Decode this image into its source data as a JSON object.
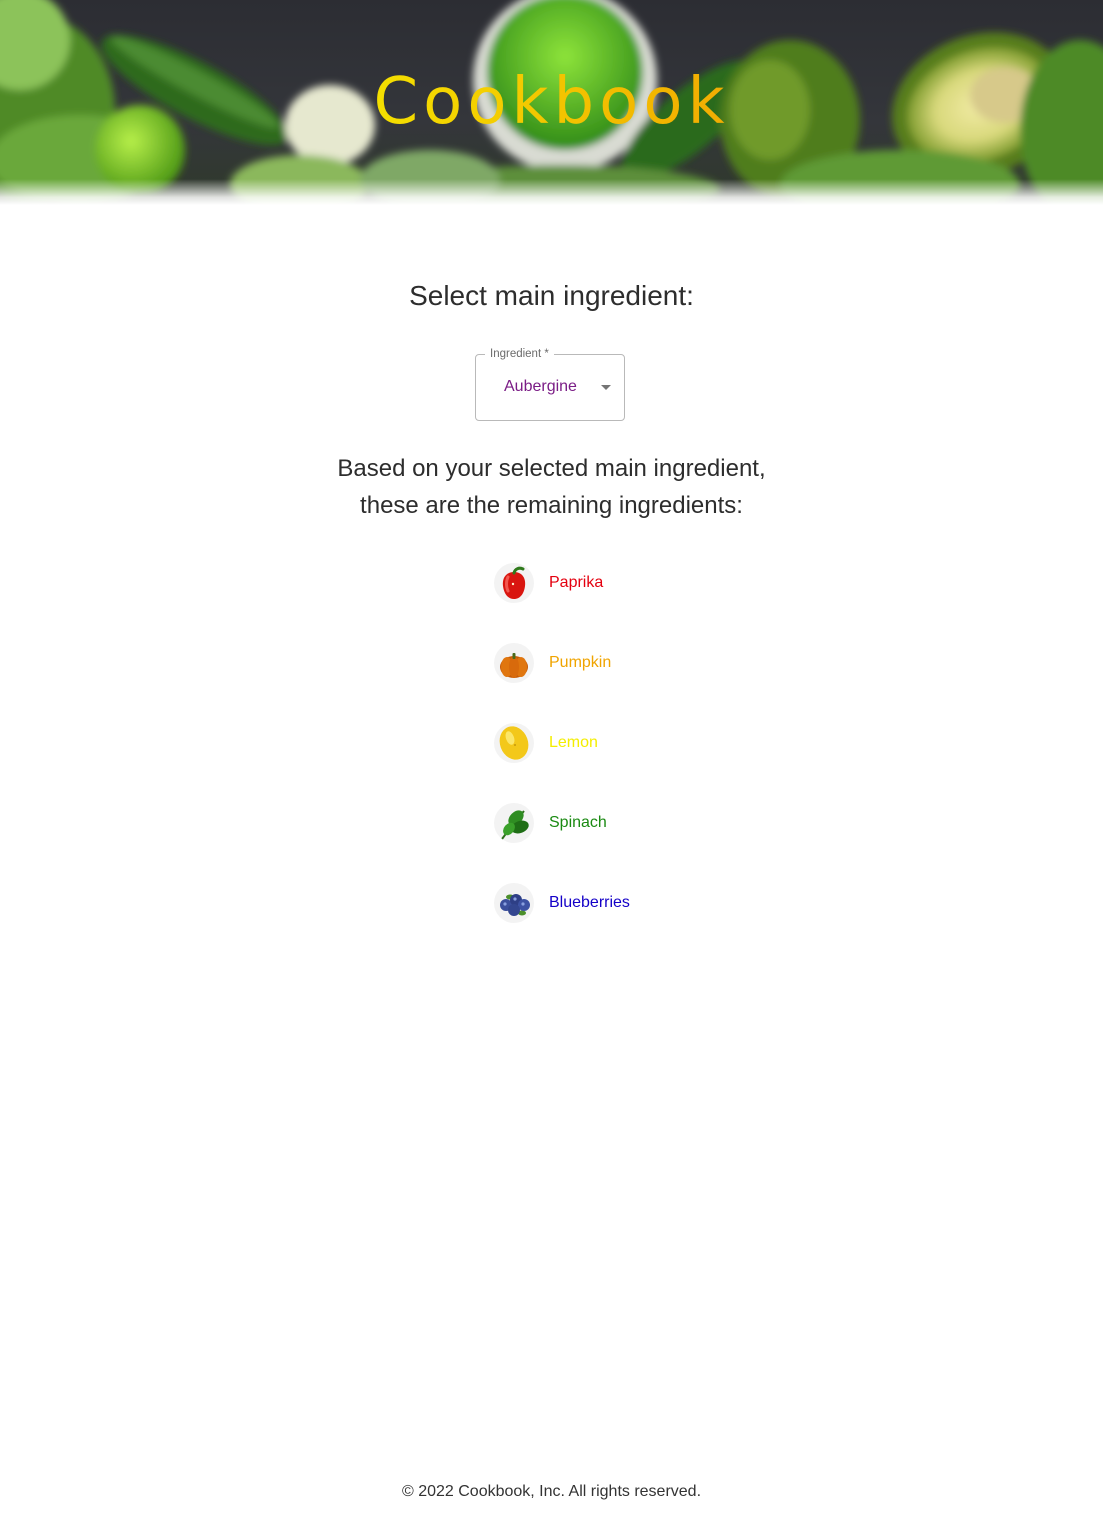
{
  "app": {
    "title": "Cookbook"
  },
  "selector": {
    "heading": "Select main ingredient:",
    "field_label": "Ingredient *",
    "selected_value": "Aubergine",
    "value_color": "#7b1d86"
  },
  "results": {
    "heading_line1": "Based on your selected main ingredient,",
    "heading_line2": "these are the remaining ingredients:",
    "items": [
      {
        "label": "Paprika",
        "color": "#e4000f",
        "icon": "paprika-icon"
      },
      {
        "label": "Pumpkin",
        "color": "#f0a400",
        "icon": "pumpkin-icon"
      },
      {
        "label": "Lemon",
        "color": "#f4ee00",
        "icon": "lemon-icon"
      },
      {
        "label": "Spinach",
        "color": "#1a8a12",
        "icon": "spinach-icon"
      },
      {
        "label": "Blueberries",
        "color": "#1400c8",
        "icon": "blueberries-icon"
      }
    ]
  },
  "footer": {
    "text": "© 2022 Cookbook, Inc. All rights reserved."
  }
}
